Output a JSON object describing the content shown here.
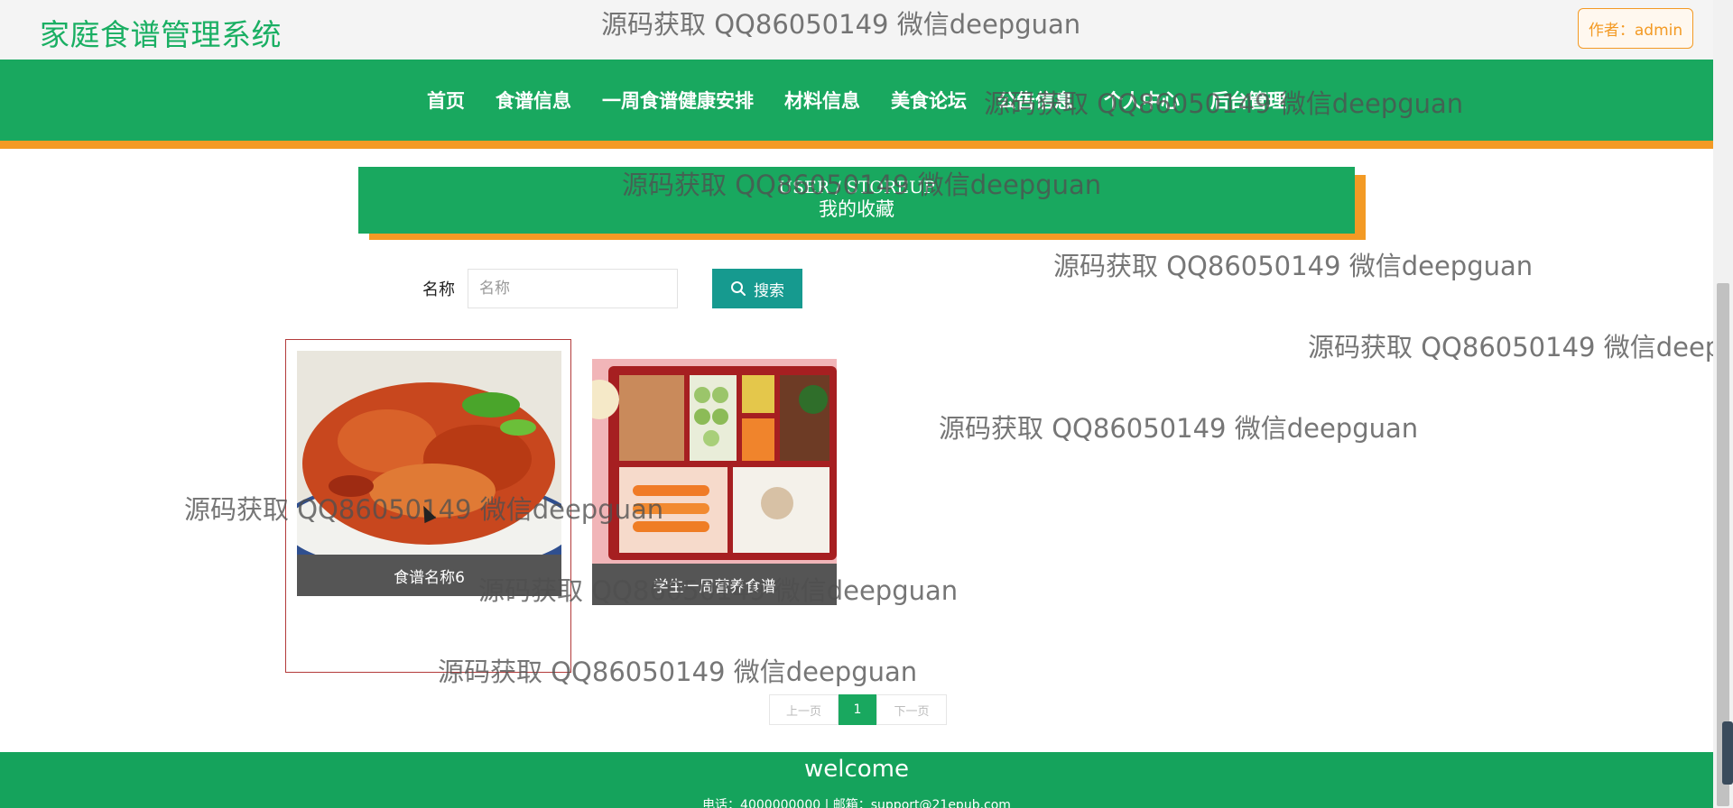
{
  "header": {
    "site_title": "家庭食谱管理系统",
    "author_label": "作者：admin"
  },
  "nav": {
    "items": [
      "首页",
      "食谱信息",
      "一周食谱健康安排",
      "材料信息",
      "美食论坛",
      "公告信息",
      "个人中心",
      "后台管理"
    ]
  },
  "banner": {
    "subtitle_en": "USER / STOREUP",
    "title": "我的收藏"
  },
  "search": {
    "label": "名称",
    "placeholder": "名称",
    "button_label": "搜索"
  },
  "cards": [
    {
      "caption": "食谱名称6",
      "image": "crayfish-dish"
    },
    {
      "caption": "学生一周营养食谱",
      "image": "bento-box-meal"
    }
  ],
  "pagination": {
    "prev_label": "上一页",
    "current_page": "1",
    "next_label": "下一页"
  },
  "footer": {
    "title": "welcome",
    "contact": "电话：4000000000 | 邮箱：support@21epub.com"
  },
  "watermark": {
    "text": "源码获取 QQ86050149 微信deepguan"
  },
  "colors": {
    "primary_green": "#19a85f",
    "accent_orange": "#f39a24",
    "search_button": "#169a8f",
    "caption_bg": "#555555"
  }
}
